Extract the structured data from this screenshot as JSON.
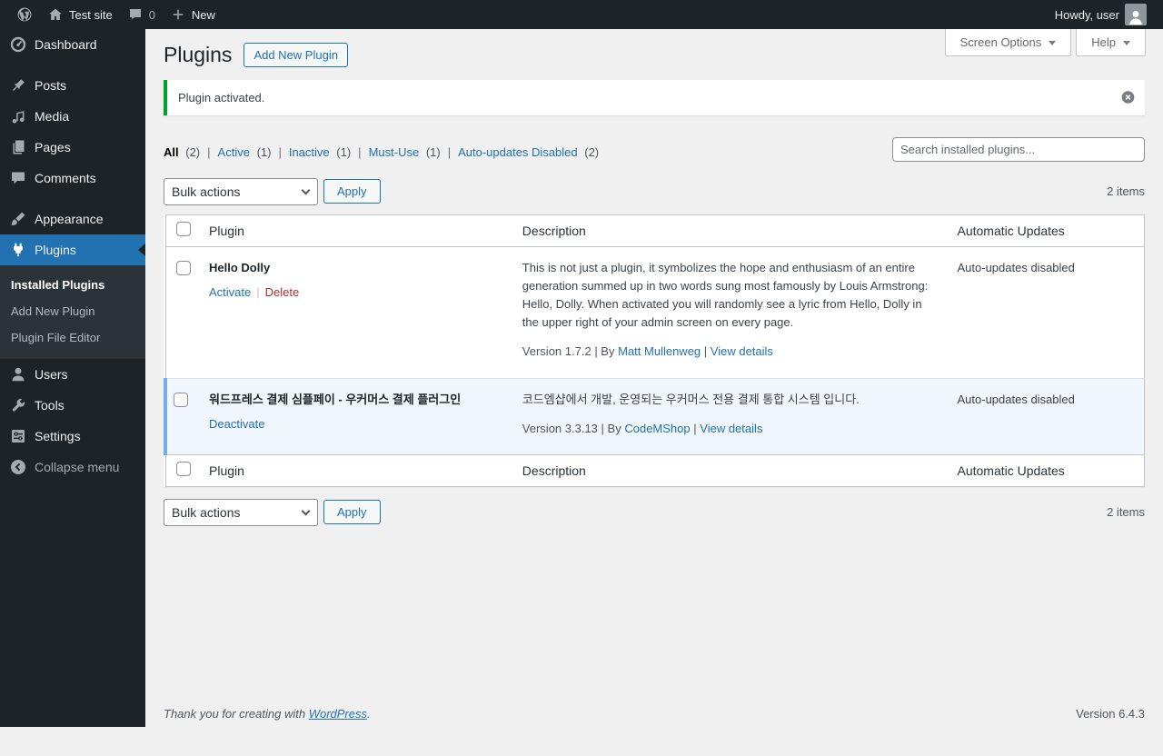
{
  "admin_bar": {
    "site_name": "Test site",
    "comments_count": "0",
    "new_label": "New",
    "howdy_text": "Howdy, user"
  },
  "sidebar": {
    "items": [
      {
        "label": "Dashboard"
      },
      {
        "label": "Posts"
      },
      {
        "label": "Media"
      },
      {
        "label": "Pages"
      },
      {
        "label": "Comments"
      },
      {
        "label": "Appearance"
      },
      {
        "label": "Plugins"
      },
      {
        "label": "Users"
      },
      {
        "label": "Tools"
      },
      {
        "label": "Settings"
      }
    ],
    "plugins_submenu": [
      {
        "label": "Installed Plugins"
      },
      {
        "label": "Add New Plugin"
      },
      {
        "label": "Plugin File Editor"
      }
    ],
    "collapse_label": "Collapse menu"
  },
  "page": {
    "title": "Plugins",
    "add_new_button": "Add New Plugin",
    "screen_options": "Screen Options",
    "help": "Help"
  },
  "notice": {
    "message": "Plugin activated."
  },
  "filters": {
    "sep": "|",
    "items": [
      {
        "label": "All",
        "count": "(2)"
      },
      {
        "label": "Active",
        "count": "(1)"
      },
      {
        "label": "Inactive",
        "count": "(1)"
      },
      {
        "label": "Must-Use",
        "count": "(1)"
      },
      {
        "label": "Auto-updates Disabled",
        "count": "(2)"
      }
    ]
  },
  "search": {
    "placeholder": "Search installed plugins..."
  },
  "tablenav": {
    "bulk_actions": "Bulk actions",
    "apply": "Apply",
    "items_count": "2 items"
  },
  "table": {
    "header": {
      "plugin": "Plugin",
      "description": "Description",
      "auto_updates": "Automatic Updates"
    },
    "rows": [
      {
        "name": "Hello Dolly",
        "action1": "Activate",
        "action_sep": "|",
        "action2": "Delete",
        "description": "This is not just a plugin, it symbolizes the hope and enthusiasm of an entire generation summed up in two words sung most famously by Louis Armstrong: Hello, Dolly. When activated you will randomly see a lyric from Hello, Dolly in the upper right of your admin screen on every page.",
        "version": "Version 1.7.2",
        "by": "| By",
        "author": "Matt Mullenweg",
        "details_sep": "|",
        "details": "View details",
        "auto_update_status": "Auto-updates disabled"
      },
      {
        "name": "워드프레스 결제 심플페이 - 우커머스 결제 플러그인",
        "action1": "Deactivate",
        "description": "코드엠샵에서 개발, 운영되는 우커머스 전용 결제 통합 시스템 입니다.",
        "version": "Version 3.3.13",
        "by": "| By",
        "author": "CodeMShop",
        "details_sep": "|",
        "details": "View details",
        "auto_update_status": "Auto-updates disabled"
      }
    ]
  },
  "footer": {
    "thanks_text": "Thank you for creating with",
    "wordpress_link": "WordPress",
    "period": ".",
    "version": "Version 6.4.3"
  },
  "colors": {
    "accent_blue": "#2271b1",
    "notice_green": "#00a32a",
    "delete_red": "#b32d2e",
    "active_row_bg": "#f0f6fc",
    "active_row_border": "#72aee6"
  }
}
